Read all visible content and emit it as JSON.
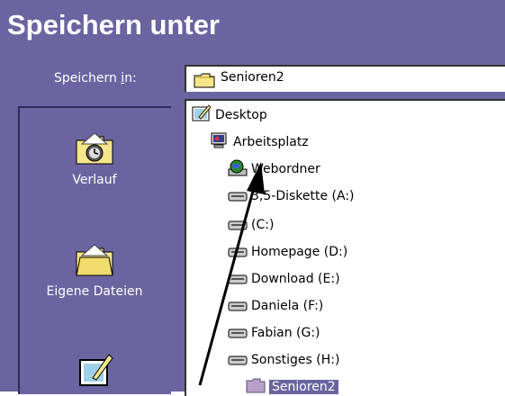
{
  "window": {
    "title": "Speichern unter"
  },
  "look_in": {
    "label_prefix": "Speichern ",
    "label_accel": "i",
    "label_suffix": "n:",
    "value": "Senioren2"
  },
  "places": [
    {
      "label": "Verlauf",
      "icon": "history-folder-icon"
    },
    {
      "label": "Eigene Dateien",
      "icon": "my-documents-folder-icon"
    },
    {
      "label": "",
      "icon": "desktop-icon"
    }
  ],
  "tree": [
    {
      "label": "Desktop",
      "icon": "desktop-icon"
    },
    {
      "label": "Arbeitsplatz",
      "icon": "computer-icon"
    },
    {
      "label": "Webordner",
      "icon": "web-folders-icon"
    },
    {
      "label": "3,5-Diskette (A:)",
      "icon": "floppy-drive-icon"
    },
    {
      "label": " (C:)",
      "icon": "hard-drive-icon"
    },
    {
      "label": "Homepage (D:)",
      "icon": "hard-drive-icon"
    },
    {
      "label": "Download (E:)",
      "icon": "hard-drive-icon"
    },
    {
      "label": "Daniela (F:)",
      "icon": "hard-drive-icon"
    },
    {
      "label": "Fabian (G:)",
      "icon": "hard-drive-icon"
    },
    {
      "label": "Sonstiges (H:)",
      "icon": "hard-drive-icon"
    },
    {
      "label": "Senioren2",
      "icon": "folder-icon",
      "selected": true
    }
  ],
  "colors": {
    "window_bg": "#6a64a0",
    "selection": "#6a64a0",
    "text": "#000000",
    "title_text": "#ffffff"
  }
}
